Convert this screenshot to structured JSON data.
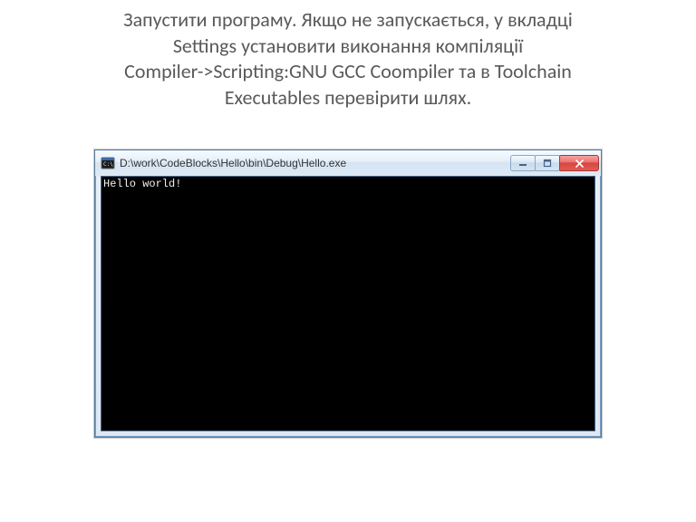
{
  "instruction": {
    "line1": "Запустити програму. Якщо не запускається, у вкладці",
    "line2": "Settings установити виконання компіляції",
    "line3": "Compiler->Scripting:GNU GCC Coompiler та в Toolchain",
    "line4": "Executables перевірити шлях."
  },
  "window": {
    "title": "D:\\work\\CodeBlocks\\Hello\\bin\\Debug\\Hello.exe",
    "icon": "console-app-icon"
  },
  "controls": {
    "minimize": "minimize-icon",
    "maximize": "maximize-icon",
    "close": "close-icon"
  },
  "console": {
    "output": "Hello world!"
  }
}
